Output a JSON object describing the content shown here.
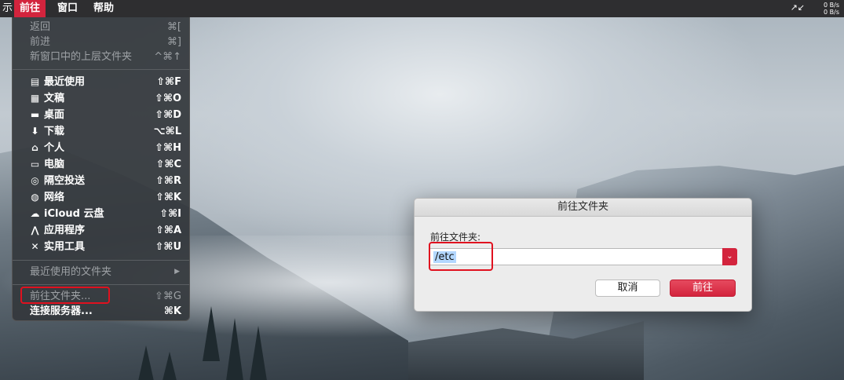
{
  "menubar": {
    "partial_left": "示",
    "items": [
      {
        "label": "前往",
        "active": true
      },
      {
        "label": "窗口",
        "active": false
      },
      {
        "label": "帮助",
        "active": false
      }
    ],
    "net_up": "0 B/s",
    "net_down": "0 B/s",
    "net_icon": "↗↙"
  },
  "go_menu": {
    "items": [
      {
        "label": "返回",
        "shortcut": "⌘[",
        "disabled": true
      },
      {
        "label": "前进",
        "shortcut": "⌘]",
        "disabled": true
      },
      {
        "label": "新窗口中的上层文件夹",
        "shortcut": "^⌘↑",
        "disabled": true
      },
      {
        "label": "最近使用",
        "shortcut": "⇧⌘F",
        "icon": "recents-icon"
      },
      {
        "label": "文稿",
        "shortcut": "⇧⌘O",
        "icon": "documents-icon"
      },
      {
        "label": "桌面",
        "shortcut": "⇧⌘D",
        "icon": "desktop-icon"
      },
      {
        "label": "下载",
        "shortcut": "⌥⌘L",
        "icon": "downloads-icon"
      },
      {
        "label": "个人",
        "shortcut": "⇧⌘H",
        "icon": "home-icon"
      },
      {
        "label": "电脑",
        "shortcut": "⇧⌘C",
        "icon": "computer-icon"
      },
      {
        "label": "隔空投送",
        "shortcut": "⇧⌘R",
        "icon": "airdrop-icon"
      },
      {
        "label": "网络",
        "shortcut": "⇧⌘K",
        "icon": "network-icon"
      },
      {
        "label": "iCloud 云盘",
        "shortcut": "⇧⌘I",
        "icon": "icloud-icon"
      },
      {
        "label": "应用程序",
        "shortcut": "⇧⌘A",
        "icon": "applications-icon"
      },
      {
        "label": "实用工具",
        "shortcut": "⇧⌘U",
        "icon": "utilities-icon"
      },
      {
        "label": "最近使用的文件夹",
        "submenu_arrow": "▶",
        "disabled": true
      },
      {
        "label": "前往文件夹...",
        "shortcut": "⇧⌘G",
        "disabled": true
      },
      {
        "label": "连接服务器...",
        "shortcut": "⌘K",
        "disabled": false
      }
    ]
  },
  "dialog": {
    "title": "前往文件夹",
    "field_label": "前往文件夹:",
    "path_value": "/etc",
    "cancel_label": "取消",
    "go_label": "前往",
    "dropdown_glyph": "⌄"
  },
  "colors": {
    "accent": "#d3243d",
    "highlight": "#e0111f",
    "selection": "#b3d7ff"
  }
}
